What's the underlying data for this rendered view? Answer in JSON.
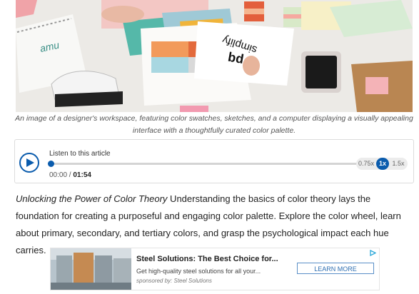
{
  "hero": {
    "notebook_text": "amu",
    "card_text": "simplify",
    "card_text_2": "pq"
  },
  "caption": {
    "line1": "An image of a designer's workspace, featuring color swatches, sketches, and a computer displaying a visually appealing",
    "line2": "interface with a thoughtfully curated color palette."
  },
  "player": {
    "label": "Listen to this article",
    "current_time": "00:00",
    "separator": " / ",
    "duration": "01:54",
    "progress": 0,
    "speeds": [
      "0.75x",
      "1x",
      "1.5x"
    ],
    "selected_speed": "1x",
    "accent": "#0b5cad"
  },
  "article": {
    "title": "Unlocking the Power of Color Theory",
    "body": " Understanding the basics of color theory lays the foundation for creating a purposeful and engaging color palette. Explore the color wheel, learn about primary, secondary, and tertiary colors, and grasp the psychological impact each hue carries."
  },
  "ad": {
    "title": "Steel Solutions: The Best Choice for...",
    "description": "Get high-quality steel solutions for all your...",
    "sponsor": "sponsored by: Steel Solutions",
    "cta": "LEARN MORE",
    "choice_icon": "adchoices-icon"
  }
}
